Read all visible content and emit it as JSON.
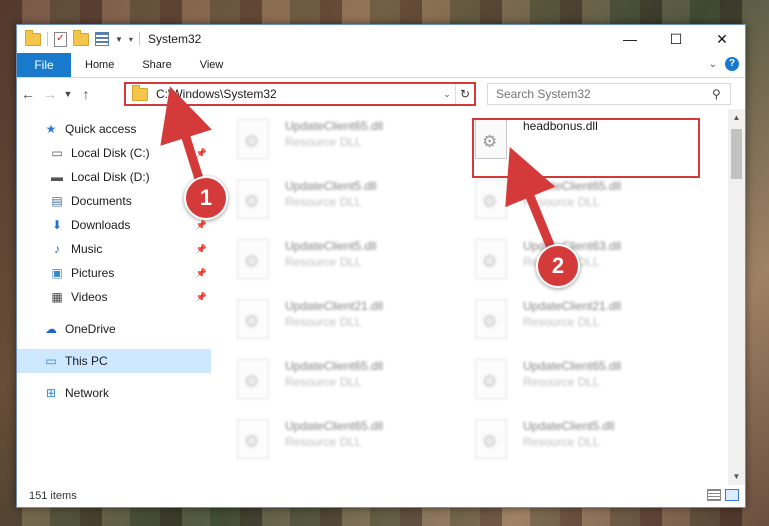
{
  "window": {
    "title": "System32",
    "controls": {
      "minimize": "—",
      "maximize": "☐",
      "close": "✕"
    }
  },
  "ribbon": {
    "tabs": [
      "File",
      "Home",
      "Share",
      "View"
    ]
  },
  "navigation": {
    "address_path": "C:\\Windows\\System32",
    "search_placeholder": "Search System32"
  },
  "sidebar": {
    "items": [
      {
        "label": "Quick access",
        "icon": "star-icon",
        "pinned": false
      },
      {
        "label": "Local Disk (C:)",
        "icon": "drive-icon",
        "pinned": true
      },
      {
        "label": "Local Disk (D:)",
        "icon": "drive-icon",
        "pinned": false
      },
      {
        "label": "Documents",
        "icon": "document-icon",
        "pinned": true
      },
      {
        "label": "Downloads",
        "icon": "download-icon",
        "pinned": true
      },
      {
        "label": "Music",
        "icon": "music-icon",
        "pinned": true
      },
      {
        "label": "Pictures",
        "icon": "pictures-icon",
        "pinned": true
      },
      {
        "label": "Videos",
        "icon": "video-icon",
        "pinned": true
      },
      {
        "label": "OneDrive",
        "icon": "cloud-icon",
        "pinned": false
      },
      {
        "label": "This PC",
        "icon": "computer-icon",
        "pinned": false,
        "selected": true
      },
      {
        "label": "Network",
        "icon": "network-icon",
        "pinned": false
      }
    ]
  },
  "files": {
    "left_column": [
      {
        "name": "UpdateClient65.dll",
        "type": "Resource DLL"
      },
      {
        "name": "UpdateClient5.dll",
        "type": "Resource DLL"
      },
      {
        "name": "UpdateClient5.dll",
        "type": "Resource DLL"
      },
      {
        "name": "UpdateClient21.dll",
        "type": "Resource DLL"
      },
      {
        "name": "UpdateClient65.dll",
        "type": "Resource DLL"
      },
      {
        "name": "UpdateClient65.dll",
        "type": "Resource DLL"
      }
    ],
    "right_column": [
      {
        "name": "headbonus.dll",
        "type": ""
      },
      {
        "name": "UpdateClient65.dll",
        "type": "Resource DLL"
      },
      {
        "name": "UpdateClient63.dll",
        "type": "Resource DLL"
      },
      {
        "name": "UpdateClient21.dll",
        "type": "Resource DLL"
      },
      {
        "name": "UpdateClient65.dll",
        "type": "Resource DLL"
      },
      {
        "name": "UpdateClient5.dll",
        "type": "Resource DLL"
      }
    ]
  },
  "status": {
    "item_count": "151 items"
  },
  "annotations": {
    "step1": "1",
    "step2": "2",
    "color": "#d53a3a"
  }
}
